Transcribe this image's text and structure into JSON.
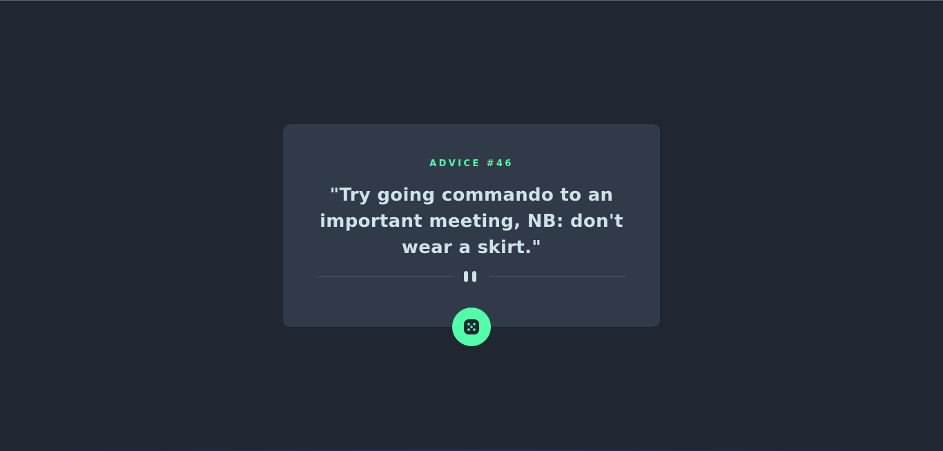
{
  "card": {
    "advice_id": "ADVICE #46",
    "advice_text": "\"Try going commando to an important meeting, NB: don't wear a skirt.\""
  },
  "icons": {
    "divider": "pause-icon",
    "button": "dice-icon"
  },
  "colors": {
    "background": "#202632",
    "card": "#313a49",
    "accent": "#52ffa8",
    "text": "#cee3e9",
    "divider": "#4f5d74"
  }
}
